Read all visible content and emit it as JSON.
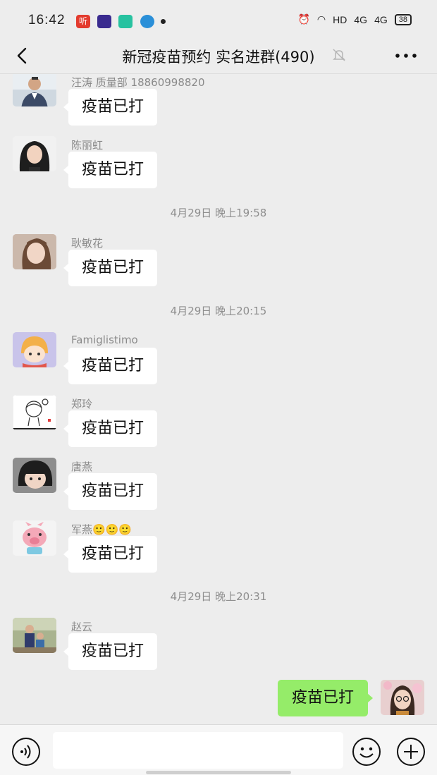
{
  "status_bar": {
    "time": "16:42",
    "app_icon_1": "听",
    "network": "HD",
    "signal_1": "4G",
    "signal_2": "4G",
    "battery": "38"
  },
  "nav": {
    "title": "新冠疫苗预约 实名进群(490)"
  },
  "messages": [
    {
      "sender": "汪涛 质量部 18860998820",
      "text": "疫苗已打"
    },
    {
      "sender": "陈丽虹",
      "text": "疫苗已打"
    },
    {
      "sender": "耿敏花",
      "text": "疫苗已打"
    },
    {
      "sender": "Famiglistimo",
      "text": "疫苗已打"
    },
    {
      "sender": "郑玲",
      "text": "疫苗已打"
    },
    {
      "sender": "唐燕",
      "text": "疫苗已打"
    },
    {
      "sender": "军燕🙂🙂🙂",
      "text": "疫苗已打"
    },
    {
      "sender": "赵云",
      "text": "疫苗已打"
    }
  ],
  "timestamps": [
    "4月29日 晚上19:58",
    "4月29日 晚上20:15",
    "4月29日 晚上20:31"
  ],
  "self_message": {
    "text": "疫苗已打"
  },
  "icons": {
    "back": "chevron-left-icon",
    "mute": "bell-off-icon",
    "more": "more-dots-icon",
    "voice": "voice-icon",
    "emoji": "emoji-icon",
    "plus": "plus-icon"
  },
  "colors": {
    "background": "#ededed",
    "bubble_other": "#ffffff",
    "bubble_self": "#95ec69",
    "secondary_text": "#8a8a8a"
  }
}
